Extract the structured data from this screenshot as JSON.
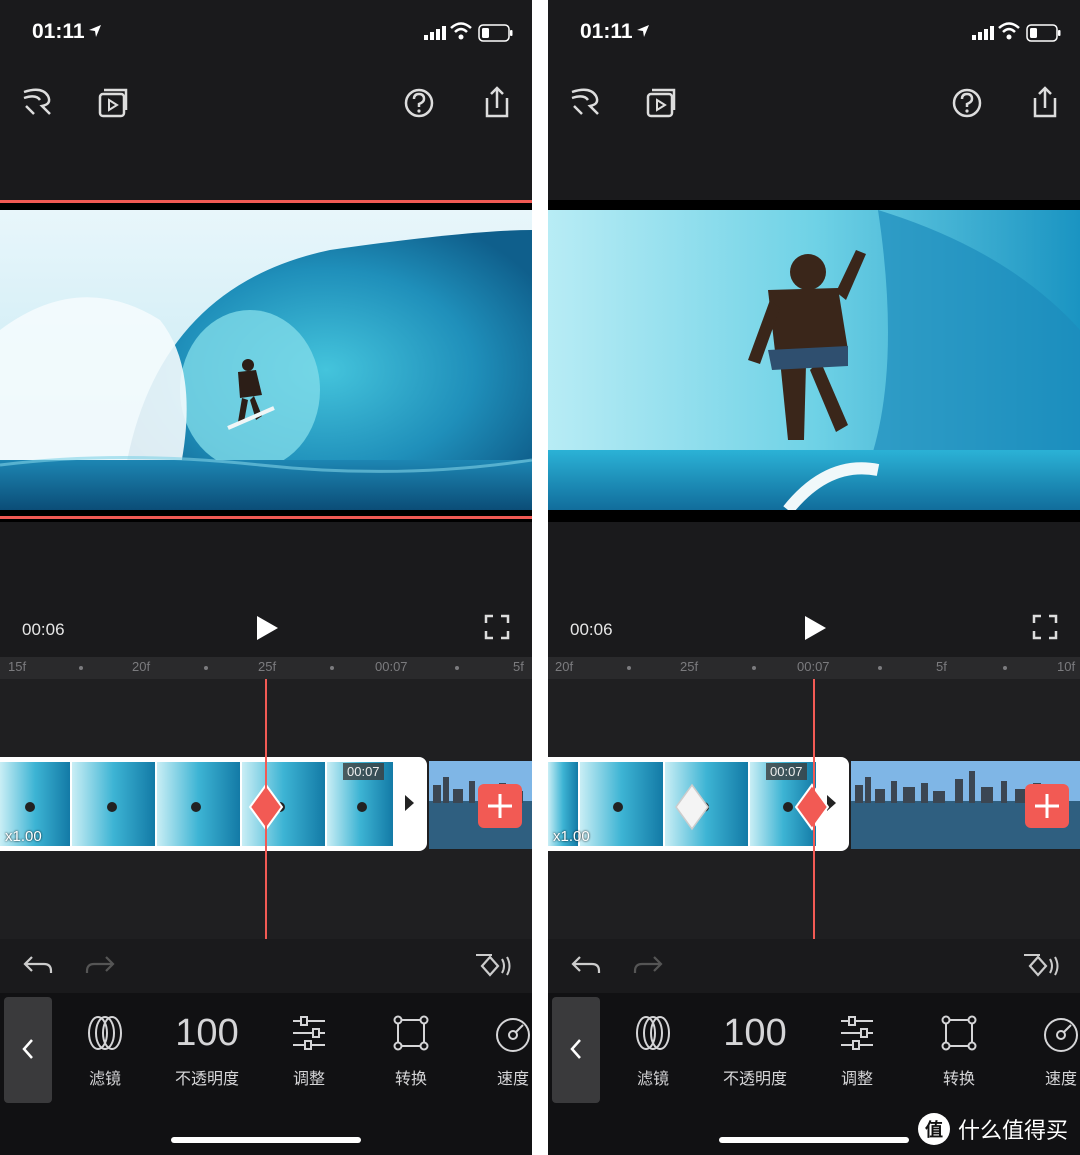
{
  "colors": {
    "accent": "#f25a54",
    "background": "#1a1a1c",
    "text": "#ffffff"
  },
  "status_bar": {
    "time": "01:11"
  },
  "toolbar": {
    "icons": [
      "curve-arrow-icon",
      "video-library-icon",
      "help-icon",
      "share-icon"
    ]
  },
  "panels": [
    {
      "playback_time": "00:06",
      "ruler_labels": [
        "15f",
        "20f",
        "25f",
        "00:07",
        "5f"
      ],
      "clip_speed": "x1.00",
      "clip_time_badge": "00:07",
      "add_label": "+"
    },
    {
      "playback_time": "00:06",
      "ruler_labels": [
        "20f",
        "25f",
        "00:07",
        "5f",
        "10f"
      ],
      "clip_speed": "x1.00",
      "clip_time_badge": "00:07",
      "add_label": "+"
    }
  ],
  "tools": {
    "back_label": "‹",
    "items": [
      {
        "icon": "filter-icon",
        "label": "滤镜"
      },
      {
        "icon": "opacity-value",
        "label": "不透明度",
        "value": "100"
      },
      {
        "icon": "adjust-sliders-icon",
        "label": "调整"
      },
      {
        "icon": "transform-icon",
        "label": "转换"
      },
      {
        "icon": "speed-gauge-icon",
        "label": "速度"
      }
    ]
  },
  "watermark": {
    "logo_char": "值",
    "text": "什么值得买"
  }
}
